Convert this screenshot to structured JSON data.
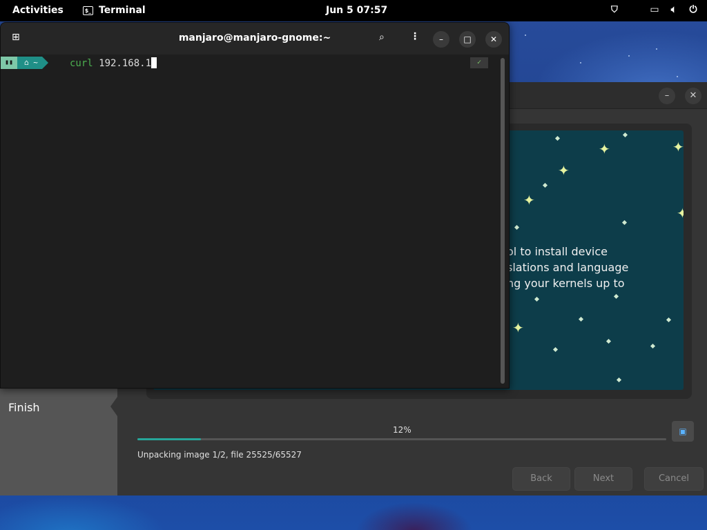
{
  "topbar": {
    "activities": "Activities",
    "app_name": "Terminal",
    "app_icon": "$_",
    "clock": "Jun 5  07:57",
    "tray_icons": [
      "shield-icon",
      "network-icon",
      "volume-icon",
      "power-icon"
    ]
  },
  "terminal": {
    "title": "manjaro@manjaro-gnome:~",
    "prompt_home": "~",
    "command_keyword": "curl",
    "command_arg": " 192.168.1",
    "status_mark": "✓"
  },
  "installer": {
    "sidebar_current": "Finish",
    "slide_text": "ol to install device\nslations and language\nng your kernels up to",
    "progress_percent": 12,
    "progress_label": "12%",
    "status": "Unpacking image 1/2, file 25525/65527",
    "buttons": {
      "back": "Back",
      "next": "Next",
      "cancel": "Cancel"
    },
    "header_buttons": {
      "minimize": "–",
      "close": "✕"
    }
  },
  "colors": {
    "accent": "#26a69a",
    "slide_bg": "#0d3d4a",
    "topbar": "#000000"
  }
}
